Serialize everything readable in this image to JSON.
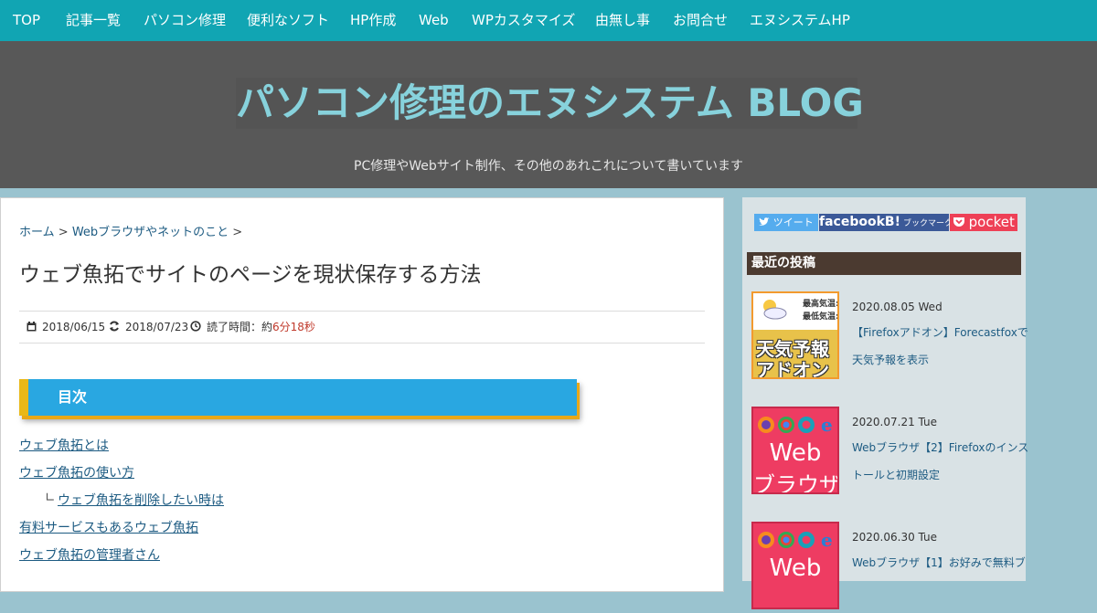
{
  "nav": [
    "TOP",
    "記事一覧",
    "パソコン修理",
    "便利なソフト",
    "HP作成",
    "Web",
    "WPカスタマイズ",
    "由無し事",
    "お問合せ",
    "エヌシステムHP"
  ],
  "header": {
    "title": "パソコン修理のエヌシステム BLOG",
    "subtitle": "PC修理やWebサイト制作、その他のあれこれについて書いています"
  },
  "breadcrumb": {
    "home": "ホーム",
    "sep": ">",
    "category": "Webブラウザやネットのこと"
  },
  "post": {
    "title": "ウェブ魚拓でサイトのページを現状保存する方法",
    "published": "2018/06/15",
    "updated": "2018/07/23",
    "read_label": "読了時間：約",
    "read_time": "6分18秒"
  },
  "toc": {
    "heading": "目次",
    "items": [
      "ウェブ魚拓とは",
      "ウェブ魚拓の使い方",
      "ウェブ魚拓を削除したい時は",
      "有料サービスもあるウェブ魚拓",
      "ウェブ魚拓の管理者さん"
    ],
    "sub_mark": "∟"
  },
  "share": {
    "tweet": "ツイート",
    "hatena": "facebookB!",
    "hatena_sub": "ブックマーク",
    "pocket": "pocket"
  },
  "sidebar": {
    "recent_heading": "最近の投稿",
    "posts": [
      {
        "date": "2020.08.05 Wed",
        "title": "【Firefoxアドオン】Forecastfoxで天気予報を表示",
        "thumb_line1": "天気予報",
        "thumb_line2": "アドオン",
        "thumb_small1": "最高気温:",
        "thumb_small2": "最低気温:"
      },
      {
        "date": "2020.07.21 Tue",
        "title": "Webブラウザ【2】Firefoxのインストールと初期設定",
        "thumb_line1": "Web",
        "thumb_line2": "ブラウザ"
      },
      {
        "date": "2020.06.30 Tue",
        "title": "Webブラウザ【1】お好みで無料ブ",
        "thumb_line1": "Web",
        "thumb_line2": ""
      }
    ]
  },
  "colors": {
    "nav": "#11a5b3",
    "header": "#585858",
    "title": "#87d2dc",
    "toc": "#29a7e1",
    "toc_accent": "#e9b817"
  }
}
